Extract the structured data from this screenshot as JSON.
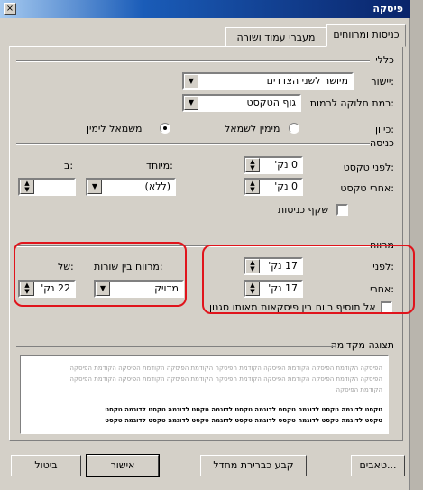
{
  "window": {
    "title": "פיסקה",
    "close_glyph": "×"
  },
  "tabs": [
    {
      "label": "כניסות ומרווחים",
      "active": true
    },
    {
      "label": "מעברי עמוד ושורה",
      "active": false
    }
  ],
  "general": {
    "section": "כללי",
    "alignment_label": "יישור:",
    "alignment_value": "מיושר לשני הצדדים",
    "outline_label": "רמת חלוקה לרמות:",
    "outline_value": "גוף הטקסט",
    "direction_label": "כיוון:",
    "rtl_label": "מימין לשמאל",
    "ltr_label": "משמאל לימין",
    "ltr_selected": true
  },
  "indentation": {
    "section": "כניסה",
    "before_label": "לפני טקסט:",
    "before_value": "0 נק'",
    "after_label": "אחרי טקסט:",
    "after_value": "0 נק'",
    "special_label": "מיוחד:",
    "special_value": "(ללא)",
    "by_label": "ב:",
    "by_value": "",
    "mirror_label": "שקף כניסות"
  },
  "spacing": {
    "section": "מרווח",
    "before_label": "לפני:",
    "before_value": "17 נק'",
    "after_label": "אחרי:",
    "after_value": "17 נק'",
    "no_space_label": "אל תוסיף רווח בין פיסקאות מאותו סגנון",
    "line_spacing_label": "מרווח בין שורות:",
    "line_spacing_value": "מדויק",
    "at_label": "של:",
    "at_value": "22 נק'"
  },
  "preview": {
    "section": "תצוגה מקדימה",
    "prev_text": "הפיסקה הקודמת הפיסקה הקודמת הפיסקה הקודמת הפיסקה הקודמת הפיסקה הקודמת הפיסקה הקודמת הפיסקה",
    "prev_last": "הקודמת הפיסקה",
    "sample_text": "טקסט לדוגמה טקסט לדוגמה טקסט לדוגמה טקסט לדוגמה טקסט לדוגמה טקסט לדוגמה טקסט"
  },
  "buttons": {
    "tabs": "טאבים...",
    "set_default": "קבע כברירת מחדל",
    "ok": "אישור",
    "cancel": "ביטול"
  },
  "colors": {
    "annotation": "#e0141c",
    "title_bar": "#0a246a"
  },
  "icons": {
    "dropdown": "▼",
    "spin_up": "▲",
    "spin_down": "▼"
  }
}
